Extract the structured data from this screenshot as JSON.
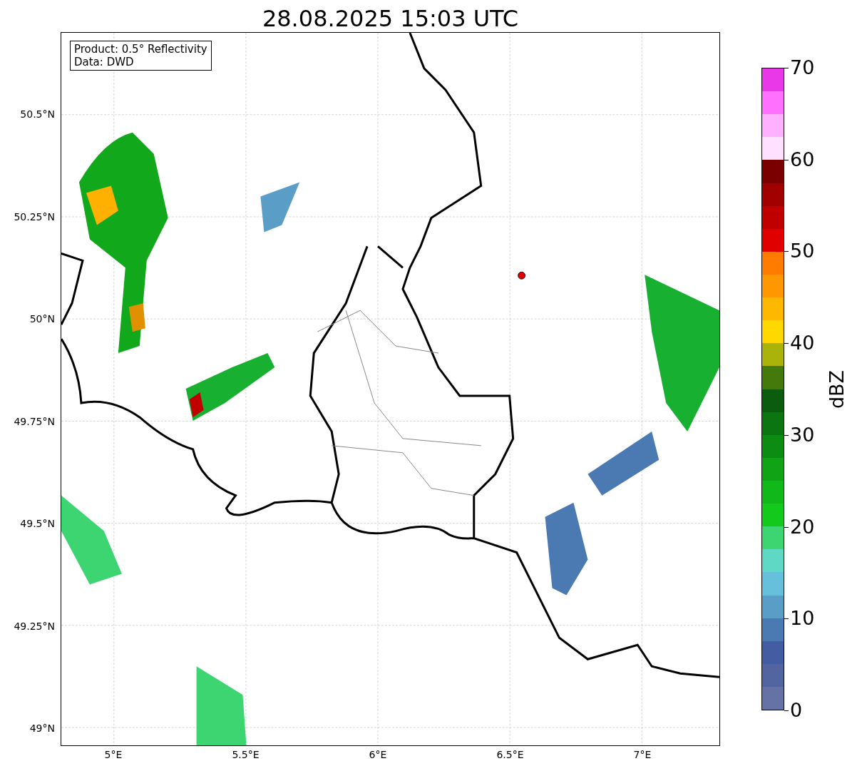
{
  "title": "28.08.2025 15:03 UTC",
  "legend": [
    "Product: 0.5° Reflectivity",
    "Data: DWD"
  ],
  "y_ticks": [
    "50.5°N",
    "50.25°N",
    "50°N",
    "49.75°N",
    "49.5°N",
    "49.25°N",
    "49°N"
  ],
  "x_ticks": [
    "5°E",
    "5.5°E",
    "6°E",
    "6.5°E",
    "7°E"
  ],
  "colorbar": {
    "label": "dBZ",
    "ticks": [
      "70",
      "60",
      "50",
      "40",
      "30",
      "20",
      "10",
      "0"
    ],
    "colors": [
      {
        "color": "#e838e8"
      },
      {
        "color": "#ff70ff"
      },
      {
        "color": "#ffb0ff"
      },
      {
        "color": "#ffe0ff"
      },
      {
        "color": "#7a0000"
      },
      {
        "color": "#a00000"
      },
      {
        "color": "#c00000"
      },
      {
        "color": "#e00000"
      },
      {
        "color": "#ff7c00"
      },
      {
        "color": "#ff9800"
      },
      {
        "color": "#ffb800"
      },
      {
        "color": "#ffd800"
      },
      {
        "color": "#aab30a"
      },
      {
        "color": "#447a0c"
      },
      {
        "color": "#0b5c0e"
      },
      {
        "color": "#0b7512"
      },
      {
        "color": "#0d8c14"
      },
      {
        "color": "#0fa315"
      },
      {
        "color": "#10b81a"
      },
      {
        "color": "#12c91c"
      },
      {
        "color": "#3dd572"
      },
      {
        "color": "#5fd8c4"
      },
      {
        "color": "#66c0dc"
      },
      {
        "color": "#5a9ec8"
      },
      {
        "color": "#4b7ab3"
      },
      {
        "color": "#435da2"
      },
      {
        "color": "#5265a0"
      },
      {
        "color": "#6472a6"
      }
    ]
  }
}
